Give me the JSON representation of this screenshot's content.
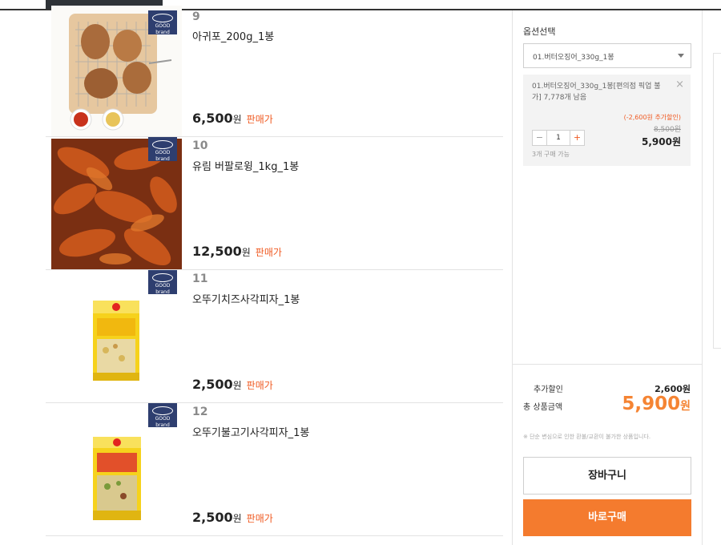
{
  "products": [
    {
      "number": "9",
      "name": "아귀포_200g_1봉",
      "price": "6,500",
      "unit": "원",
      "price_tag": "판매가",
      "badge_lines": [
        "GOOD brand"
      ]
    },
    {
      "number": "10",
      "name": "유림 버팔로윙_1kg_1봉",
      "price": "12,500",
      "unit": "원",
      "price_tag": "판매가",
      "badge_lines": [
        "GOOD brand"
      ]
    },
    {
      "number": "11",
      "name": "오뚜기치즈사각피자_1봉",
      "price": "2,500",
      "unit": "원",
      "price_tag": "판매가",
      "badge_lines": [
        "GOOD brand"
      ]
    },
    {
      "number": "12",
      "name": "오뚜기불고기사각피자_1봉",
      "price": "2,500",
      "unit": "원",
      "price_tag": "판매가",
      "badge_lines": [
        "GOOD brand"
      ]
    }
  ],
  "option": {
    "title": "옵션선택",
    "selected": "01.버터오징어_330g_1봉",
    "item_text": "01.버터오징어_330g_1봉[편의점 픽업 불가] 7,778개 남음",
    "discount": "(-2,600원 추가할인)",
    "original_price": "8,500원",
    "final_price": "5,900원",
    "qty": "1",
    "minus": "−",
    "plus": "+",
    "limit": "3개 구매 가능",
    "close": "×"
  },
  "summary": {
    "add_discount_label": "추가할인",
    "add_discount_value": "2,600원",
    "total_label": "총 상품금액",
    "total_value": "5,900",
    "total_unit": "원",
    "notice": "※ 단순 변심으로 인한 환불/교환이 불가한 상품입니다."
  },
  "buttons": {
    "cart": "장바구니",
    "buy": "바로구매"
  },
  "colors": {
    "accent": "#f47b2e",
    "badge": "#2e3e6f",
    "discount": "#f05a22"
  }
}
